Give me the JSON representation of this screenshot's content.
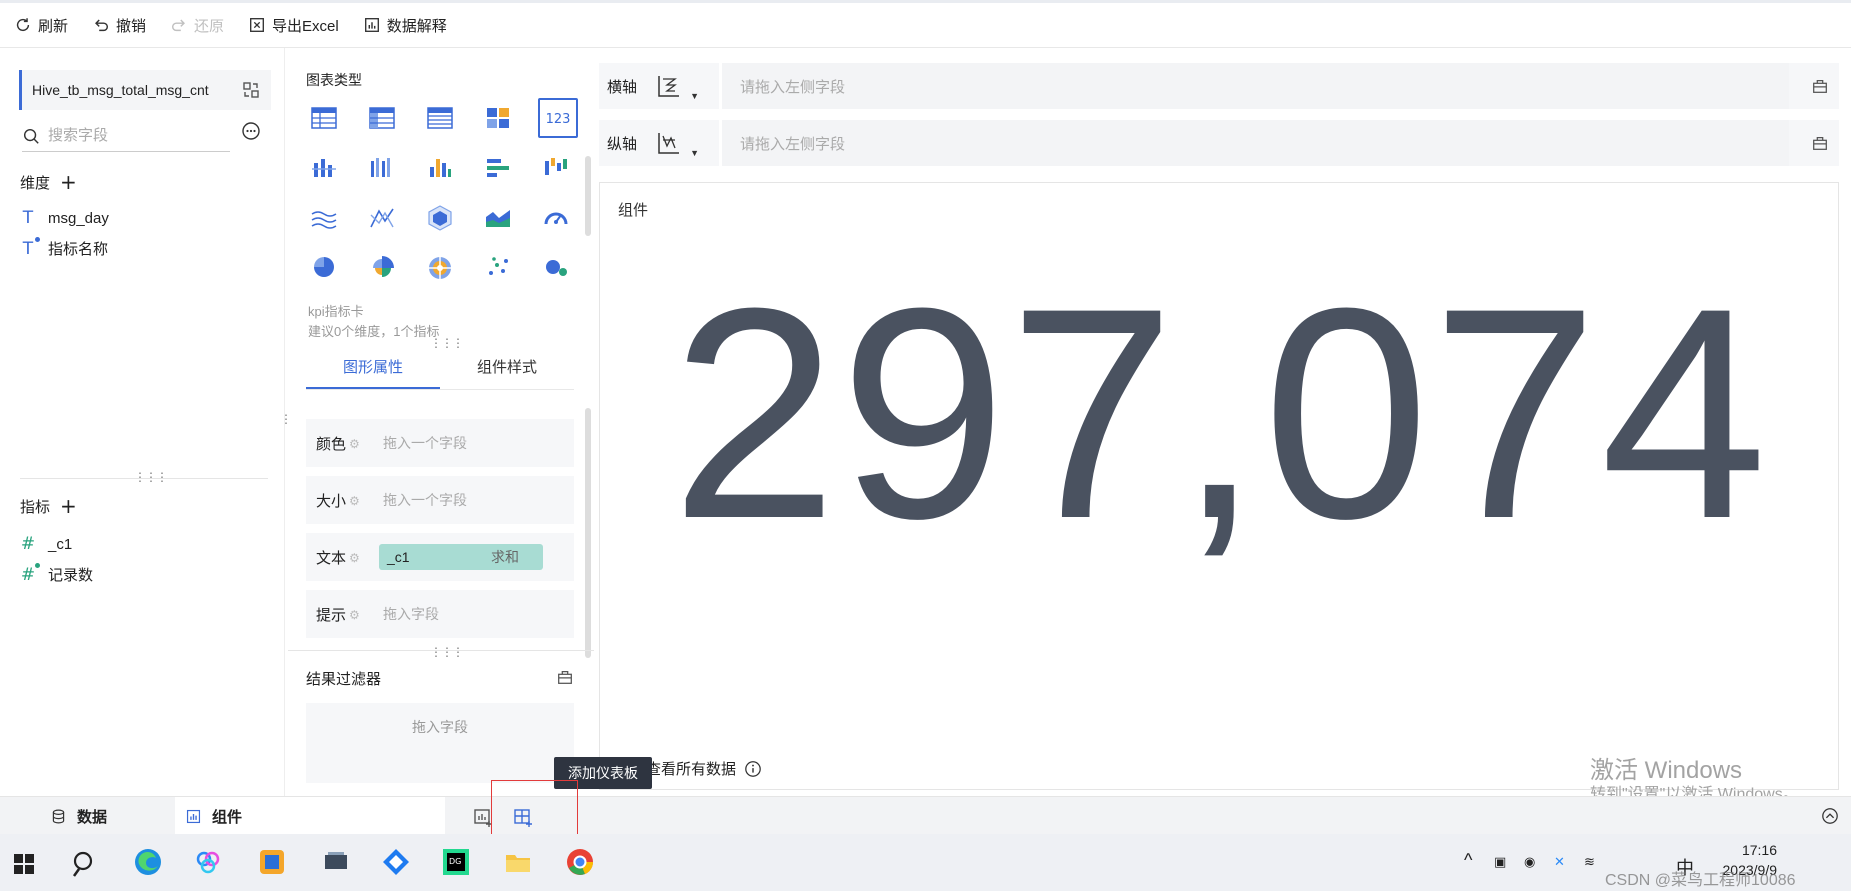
{
  "toolbar": {
    "refresh": "刷新",
    "undo": "撤销",
    "redo": "还原",
    "export_excel": "导出Excel",
    "data_explain": "数据解释"
  },
  "left_panel": {
    "dataset_name": "Hive_tb_msg_total_msg_cnt",
    "search_placeholder": "搜索字段",
    "dimensions_title": "维度",
    "dimensions": [
      {
        "icon": "text-type-icon",
        "name": "msg_day"
      },
      {
        "icon": "text-type-derived-icon",
        "name": "指标名称"
      }
    ],
    "metrics_title": "指标",
    "metrics": [
      {
        "icon": "number-type-icon",
        "name": "_c1"
      },
      {
        "icon": "number-type-derived-icon",
        "name": "记录数"
      }
    ]
  },
  "middle_panel": {
    "chart_type_title": "图表类型",
    "selected_chart_name": "kpi指标卡",
    "selected_chart_desc": "建议0个维度，1个指标",
    "kpi_icon_text": "123",
    "tabs": [
      "图形属性",
      "组件样式"
    ],
    "props": [
      {
        "label": "颜色",
        "placeholder": "拖入一个字段"
      },
      {
        "label": "大小",
        "placeholder": "拖入一个字段"
      },
      {
        "label": "文本",
        "field": "_c1",
        "aggregation": "求和"
      },
      {
        "label": "提示",
        "placeholder": "拖入字段"
      }
    ],
    "result_filter_title": "结果过滤器",
    "filter_drop_placeholder": "拖入字段"
  },
  "axes": {
    "x_label": "横轴",
    "y_label": "纵轴",
    "x_placeholder": "请拖入左侧字段",
    "y_placeholder": "请拖入左侧字段"
  },
  "canvas": {
    "component_title": "组件",
    "kpi_value": "297,074",
    "view_all_data": "查看所有数据"
  },
  "tooltip": "添加仪表板",
  "bottom_tabs": {
    "data": "数据",
    "component": "组件"
  },
  "watermark": {
    "line1": "激活 Windows",
    "line2": "转到\"设置\"以激活 Windows。"
  },
  "taskbar": {
    "ime": "中",
    "time": "17:16",
    "date": "2023/9/9",
    "csdn_watermark": "CSDN @菜鸟工程师10086"
  },
  "colors": {
    "accent": "#3b6bd6",
    "metric_green": "#29a37e",
    "kpi_text": "#4a5260",
    "pill_bg": "#a8dcd3",
    "highlight_box": "#e23b3b"
  }
}
